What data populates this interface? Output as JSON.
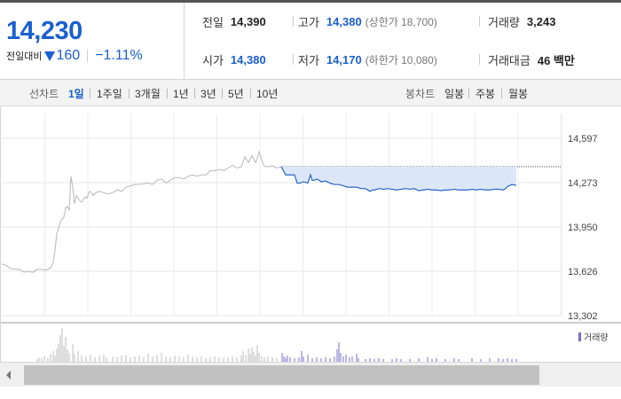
{
  "quote": {
    "price": "14,230",
    "change_label": "전일대비",
    "change_amount": "160",
    "change_rate": "−1.11%",
    "direction_icon": "down-triangle-icon",
    "color_down": "#1a5fcf"
  },
  "info": {
    "prev_close_label": "전일",
    "prev_close": "14,390",
    "high_label": "고가",
    "high": "14,380",
    "upper_limit": "(상한가 18,700)",
    "volume_label": "거래량",
    "volume": "3,243",
    "open_label": "시가",
    "open": "14,380",
    "low_label": "저가",
    "low": "14,170",
    "lower_limit": "(하한가 10,080)",
    "amount_label": "거래대금",
    "amount": "46 백만"
  },
  "tabs": {
    "line_label": "선차트",
    "line_items": [
      "1일",
      "1주일",
      "3개월",
      "1년",
      "3년",
      "5년",
      "10년"
    ],
    "line_active": "1일",
    "candle_label": "봉차트",
    "candle_items": [
      "일봉",
      "주봉",
      "월봉"
    ]
  },
  "chart_data": {
    "type": "line",
    "y_ticks": [
      "14,597",
      "14,273",
      "13,950",
      "13,626",
      "13,302"
    ],
    "ylim": [
      13302,
      14597
    ],
    "reference_value": 14390,
    "legend": "거래량",
    "series": [
      {
        "color": "#b8b8b8",
        "x": [
          0,
          5,
          10,
          15,
          20,
          25,
          30,
          35,
          40,
          45,
          50,
          55,
          58,
          60,
          62,
          65,
          67,
          70,
          72,
          74,
          76,
          78,
          80,
          82,
          84,
          86,
          88,
          90,
          92,
          94,
          96,
          98,
          100,
          103,
          106,
          110,
          115,
          120,
          125,
          130,
          135,
          140,
          145,
          150,
          155,
          160,
          165,
          170,
          175,
          180,
          185,
          190,
          195,
          200,
          205,
          210,
          215,
          220,
          225,
          230,
          235,
          240,
          245,
          250,
          255,
          260,
          265,
          270,
          274,
          278,
          282,
          286,
          288,
          290,
          292,
          295,
          298,
          300,
          305,
          310,
          315
        ],
        "y": [
          13680,
          13668,
          13645,
          13640,
          13640,
          13620,
          13625,
          13618,
          13640,
          13640,
          13635,
          13650,
          13690,
          13780,
          13900,
          13960,
          14000,
          14020,
          14090,
          14100,
          14070,
          14320,
          14240,
          14120,
          14180,
          14160,
          14140,
          14130,
          14150,
          14170,
          14160,
          14200,
          14210,
          14180,
          14200,
          14210,
          14200,
          14190,
          14200,
          14220,
          14210,
          14240,
          14250,
          14260,
          14260,
          14265,
          14270,
          14260,
          14290,
          14300,
          14270,
          14290,
          14310,
          14310,
          14300,
          14320,
          14330,
          14320,
          14330,
          14330,
          14360,
          14360,
          14370,
          14360,
          14380,
          14400,
          14380,
          14390,
          14460,
          14420,
          14470,
          14420,
          14450,
          14500,
          14460,
          14400,
          14390,
          14390,
          14395,
          14380,
          14390
        ]
      },
      {
        "color": "#2a64c8",
        "x": [
          315,
          320,
          325,
          330,
          333,
          336,
          340,
          345,
          348,
          350,
          352,
          355,
          358,
          360,
          365,
          370,
          375,
          380,
          385,
          390,
          395,
          400,
          405,
          410,
          415,
          418,
          420,
          425,
          430,
          435,
          440,
          445,
          450,
          455,
          460,
          465,
          470,
          475,
          480,
          485,
          490,
          495,
          500,
          505,
          510,
          515,
          520,
          525,
          530,
          535,
          540,
          545,
          550,
          555,
          560,
          565,
          568,
          570,
          575,
          578,
          580
        ],
        "y": [
          14390,
          14330,
          14330,
          14330,
          14270,
          14270,
          14280,
          14270,
          14330,
          14290,
          14290,
          14300,
          14290,
          14280,
          14285,
          14270,
          14260,
          14260,
          14250,
          14240,
          14240,
          14240,
          14230,
          14230,
          14210,
          14220,
          14220,
          14230,
          14225,
          14230,
          14225,
          14220,
          14225,
          14230,
          14225,
          14230,
          14215,
          14220,
          14225,
          14220,
          14220,
          14215,
          14220,
          14220,
          14225,
          14220,
          14220,
          14220,
          14225,
          14220,
          14225,
          14220,
          14220,
          14225,
          14225,
          14220,
          14230,
          14245,
          14260,
          14255,
          14255
        ]
      }
    ],
    "volume": {
      "gray": [
        [
          40,
          3
        ],
        [
          42,
          5
        ],
        [
          45,
          4
        ],
        [
          48,
          6
        ],
        [
          52,
          4
        ],
        [
          55,
          9
        ],
        [
          58,
          12
        ],
        [
          60,
          7
        ],
        [
          62,
          15
        ],
        [
          64,
          20
        ],
        [
          66,
          30
        ],
        [
          68,
          38
        ],
        [
          70,
          18
        ],
        [
          72,
          28
        ],
        [
          74,
          14
        ],
        [
          76,
          10
        ],
        [
          80,
          20
        ],
        [
          82,
          9
        ],
        [
          86,
          12
        ],
        [
          90,
          7
        ],
        [
          95,
          6
        ],
        [
          100,
          8
        ],
        [
          105,
          5
        ],
        [
          110,
          7
        ],
        [
          115,
          8
        ],
        [
          118,
          5
        ],
        [
          125,
          6
        ],
        [
          130,
          5
        ],
        [
          135,
          7
        ],
        [
          140,
          8
        ],
        [
          145,
          5
        ],
        [
          150,
          6
        ],
        [
          155,
          7
        ],
        [
          160,
          5
        ],
        [
          165,
          9
        ],
        [
          170,
          6
        ],
        [
          175,
          8
        ],
        [
          180,
          10
        ],
        [
          185,
          6
        ],
        [
          190,
          5
        ],
        [
          195,
          7
        ],
        [
          200,
          6
        ],
        [
          205,
          5
        ],
        [
          210,
          8
        ],
        [
          215,
          6
        ],
        [
          220,
          5
        ],
        [
          225,
          6
        ],
        [
          230,
          4
        ],
        [
          235,
          5
        ],
        [
          240,
          6
        ],
        [
          245,
          5
        ],
        [
          250,
          4
        ],
        [
          255,
          5
        ],
        [
          260,
          6
        ],
        [
          265,
          5
        ],
        [
          270,
          7
        ],
        [
          272,
          12
        ],
        [
          275,
          8
        ],
        [
          278,
          15
        ],
        [
          280,
          9
        ],
        [
          282,
          16
        ],
        [
          284,
          11
        ],
        [
          286,
          7
        ],
        [
          288,
          19
        ],
        [
          290,
          10
        ],
        [
          293,
          6
        ],
        [
          296,
          5
        ],
        [
          300,
          6
        ],
        [
          305,
          5
        ],
        [
          310,
          4
        ]
      ],
      "purple": [
        [
          316,
          10
        ],
        [
          318,
          6
        ],
        [
          320,
          4
        ],
        [
          322,
          7
        ],
        [
          325,
          5
        ],
        [
          330,
          4
        ],
        [
          335,
          5
        ],
        [
          338,
          12
        ],
        [
          340,
          6
        ],
        [
          345,
          8
        ],
        [
          350,
          4
        ],
        [
          355,
          5
        ],
        [
          360,
          4
        ],
        [
          365,
          5
        ],
        [
          370,
          4
        ],
        [
          375,
          6
        ],
        [
          378,
          14
        ],
        [
          380,
          22
        ],
        [
          382,
          10
        ],
        [
          385,
          6
        ],
        [
          388,
          8
        ],
        [
          392,
          5
        ],
        [
          395,
          6
        ],
        [
          400,
          9
        ],
        [
          402,
          4
        ],
        [
          410,
          3
        ],
        [
          415,
          4
        ],
        [
          420,
          3
        ],
        [
          425,
          4
        ],
        [
          430,
          3
        ],
        [
          440,
          3
        ],
        [
          445,
          4
        ],
        [
          450,
          3
        ],
        [
          460,
          3
        ],
        [
          470,
          4
        ],
        [
          480,
          5
        ],
        [
          485,
          3
        ],
        [
          490,
          4
        ],
        [
          500,
          3
        ],
        [
          510,
          4
        ],
        [
          515,
          3
        ],
        [
          530,
          4
        ],
        [
          540,
          3
        ],
        [
          550,
          4
        ],
        [
          560,
          4
        ],
        [
          565,
          3
        ],
        [
          570,
          4
        ],
        [
          575,
          3
        ],
        [
          580,
          3
        ]
      ]
    }
  }
}
